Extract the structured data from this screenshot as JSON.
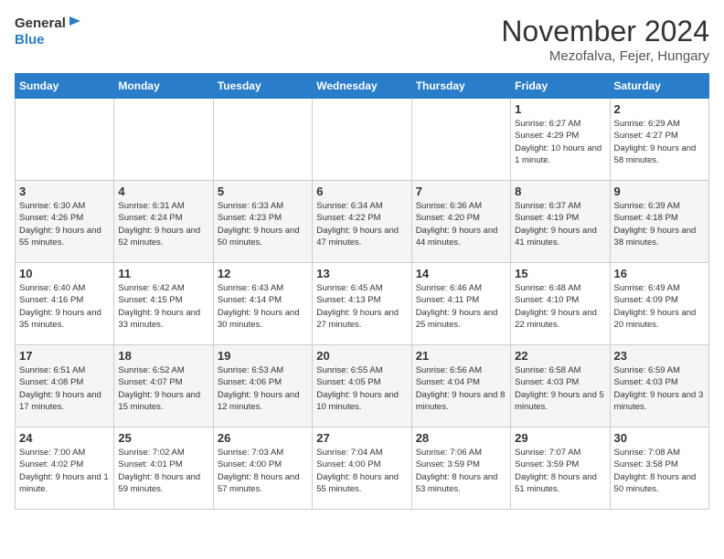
{
  "logo": {
    "general": "General",
    "blue": "Blue"
  },
  "header": {
    "month": "November 2024",
    "location": "Mezofalva, Fejer, Hungary"
  },
  "weekdays": [
    "Sunday",
    "Monday",
    "Tuesday",
    "Wednesday",
    "Thursday",
    "Friday",
    "Saturday"
  ],
  "weeks": [
    [
      {
        "day": "",
        "info": ""
      },
      {
        "day": "",
        "info": ""
      },
      {
        "day": "",
        "info": ""
      },
      {
        "day": "",
        "info": ""
      },
      {
        "day": "",
        "info": ""
      },
      {
        "day": "1",
        "info": "Sunrise: 6:27 AM\nSunset: 4:29 PM\nDaylight: 10 hours and 1 minute."
      },
      {
        "day": "2",
        "info": "Sunrise: 6:29 AM\nSunset: 4:27 PM\nDaylight: 9 hours and 58 minutes."
      }
    ],
    [
      {
        "day": "3",
        "info": "Sunrise: 6:30 AM\nSunset: 4:26 PM\nDaylight: 9 hours and 55 minutes."
      },
      {
        "day": "4",
        "info": "Sunrise: 6:31 AM\nSunset: 4:24 PM\nDaylight: 9 hours and 52 minutes."
      },
      {
        "day": "5",
        "info": "Sunrise: 6:33 AM\nSunset: 4:23 PM\nDaylight: 9 hours and 50 minutes."
      },
      {
        "day": "6",
        "info": "Sunrise: 6:34 AM\nSunset: 4:22 PM\nDaylight: 9 hours and 47 minutes."
      },
      {
        "day": "7",
        "info": "Sunrise: 6:36 AM\nSunset: 4:20 PM\nDaylight: 9 hours and 44 minutes."
      },
      {
        "day": "8",
        "info": "Sunrise: 6:37 AM\nSunset: 4:19 PM\nDaylight: 9 hours and 41 minutes."
      },
      {
        "day": "9",
        "info": "Sunrise: 6:39 AM\nSunset: 4:18 PM\nDaylight: 9 hours and 38 minutes."
      }
    ],
    [
      {
        "day": "10",
        "info": "Sunrise: 6:40 AM\nSunset: 4:16 PM\nDaylight: 9 hours and 35 minutes."
      },
      {
        "day": "11",
        "info": "Sunrise: 6:42 AM\nSunset: 4:15 PM\nDaylight: 9 hours and 33 minutes."
      },
      {
        "day": "12",
        "info": "Sunrise: 6:43 AM\nSunset: 4:14 PM\nDaylight: 9 hours and 30 minutes."
      },
      {
        "day": "13",
        "info": "Sunrise: 6:45 AM\nSunset: 4:13 PM\nDaylight: 9 hours and 27 minutes."
      },
      {
        "day": "14",
        "info": "Sunrise: 6:46 AM\nSunset: 4:11 PM\nDaylight: 9 hours and 25 minutes."
      },
      {
        "day": "15",
        "info": "Sunrise: 6:48 AM\nSunset: 4:10 PM\nDaylight: 9 hours and 22 minutes."
      },
      {
        "day": "16",
        "info": "Sunrise: 6:49 AM\nSunset: 4:09 PM\nDaylight: 9 hours and 20 minutes."
      }
    ],
    [
      {
        "day": "17",
        "info": "Sunrise: 6:51 AM\nSunset: 4:08 PM\nDaylight: 9 hours and 17 minutes."
      },
      {
        "day": "18",
        "info": "Sunrise: 6:52 AM\nSunset: 4:07 PM\nDaylight: 9 hours and 15 minutes."
      },
      {
        "day": "19",
        "info": "Sunrise: 6:53 AM\nSunset: 4:06 PM\nDaylight: 9 hours and 12 minutes."
      },
      {
        "day": "20",
        "info": "Sunrise: 6:55 AM\nSunset: 4:05 PM\nDaylight: 9 hours and 10 minutes."
      },
      {
        "day": "21",
        "info": "Sunrise: 6:56 AM\nSunset: 4:04 PM\nDaylight: 9 hours and 8 minutes."
      },
      {
        "day": "22",
        "info": "Sunrise: 6:58 AM\nSunset: 4:03 PM\nDaylight: 9 hours and 5 minutes."
      },
      {
        "day": "23",
        "info": "Sunrise: 6:59 AM\nSunset: 4:03 PM\nDaylight: 9 hours and 3 minutes."
      }
    ],
    [
      {
        "day": "24",
        "info": "Sunrise: 7:00 AM\nSunset: 4:02 PM\nDaylight: 9 hours and 1 minute."
      },
      {
        "day": "25",
        "info": "Sunrise: 7:02 AM\nSunset: 4:01 PM\nDaylight: 8 hours and 59 minutes."
      },
      {
        "day": "26",
        "info": "Sunrise: 7:03 AM\nSunset: 4:00 PM\nDaylight: 8 hours and 57 minutes."
      },
      {
        "day": "27",
        "info": "Sunrise: 7:04 AM\nSunset: 4:00 PM\nDaylight: 8 hours and 55 minutes."
      },
      {
        "day": "28",
        "info": "Sunrise: 7:06 AM\nSunset: 3:59 PM\nDaylight: 8 hours and 53 minutes."
      },
      {
        "day": "29",
        "info": "Sunrise: 7:07 AM\nSunset: 3:59 PM\nDaylight: 8 hours and 51 minutes."
      },
      {
        "day": "30",
        "info": "Sunrise: 7:08 AM\nSunset: 3:58 PM\nDaylight: 8 hours and 50 minutes."
      }
    ]
  ]
}
